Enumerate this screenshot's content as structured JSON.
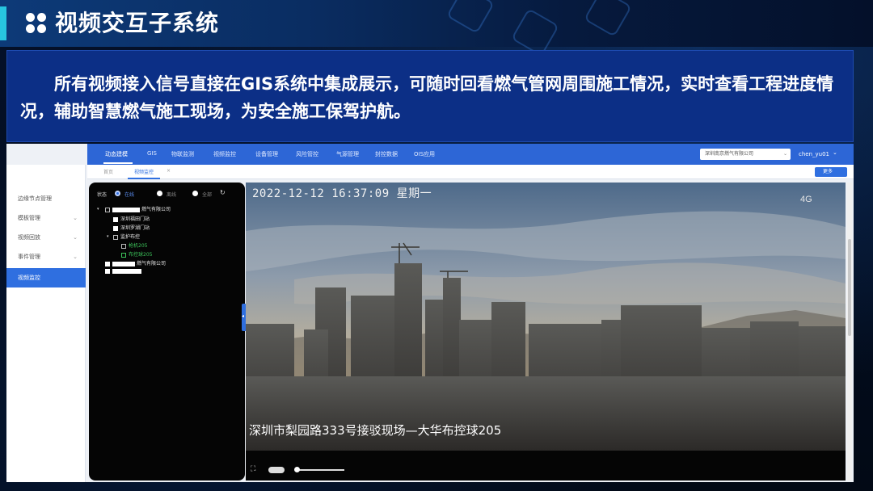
{
  "slide": {
    "title": "视频交互子系统",
    "description": "所有视频接入信号直接在GIS系统中集成展示，可随时回看燃气管网周围施工情况，实时查看工程进度情况，辅助智慧燃气施工现场，为安全施工保驾护航。"
  },
  "topnav": {
    "items": [
      "动态建模",
      "GIS",
      "物联监测",
      "视频监控",
      "设备管理",
      "风险管控",
      "气源管理",
      "封控数据",
      "OIS应用"
    ],
    "org_select": "深圳南京燃气有限公司",
    "user": "chen_yu01"
  },
  "sidebar": {
    "items": [
      {
        "label": "边缘节点管理",
        "chevron": false
      },
      {
        "label": "模板管理",
        "chevron": true
      },
      {
        "label": "视频回放",
        "chevron": true
      },
      {
        "label": "事件管理",
        "chevron": true
      },
      {
        "label": "视频监控",
        "chevron": false
      }
    ]
  },
  "tabs": {
    "items": [
      "首页",
      "视频监控"
    ],
    "more_label": "更多"
  },
  "tree": {
    "status_label": "状态",
    "radios": [
      "在线",
      "离线",
      "全部"
    ],
    "nodes": [
      {
        "label": "燃气有限公司"
      },
      {
        "label": "深圳福田门站"
      },
      {
        "label": "深圳罗湖门站"
      },
      {
        "label": "监护布控"
      },
      {
        "label": "枪机205"
      },
      {
        "label": "布控球205"
      },
      {
        "label": "燃气有限公司"
      }
    ]
  },
  "video": {
    "timestamp": "2022-12-12 16:37:09 星期一",
    "signal": "4G",
    "caption": "深圳市梨园路333号接驳现场—大华布控球205"
  },
  "colors": {
    "header_accent": "#27c6e0",
    "desc_bg": "#0c2f86",
    "nav_bg": "#2d66d6",
    "active_blue": "#2f6fe0",
    "tree_green": "#3cc35a"
  }
}
